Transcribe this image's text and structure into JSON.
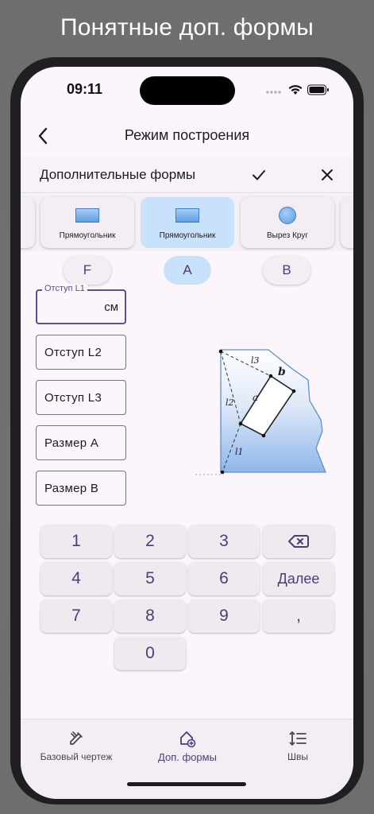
{
  "promo_title": "Понятные доп. формы",
  "status": {
    "time": "09:11"
  },
  "nav": {
    "title": "Режим построения",
    "back_icon": "chevron-left-icon"
  },
  "sheet": {
    "title": "Дополнительные формы",
    "confirm_icon": "check-icon",
    "close_icon": "close-icon"
  },
  "shapes": [
    {
      "label": "Прямоугольник",
      "icon": "rectangle-icon",
      "selected": false
    },
    {
      "label": "Прямоугольник",
      "icon": "rectangle-icon",
      "selected": true
    },
    {
      "label": "Вырез Круг",
      "icon": "circle-icon",
      "selected": false
    }
  ],
  "tabs": [
    {
      "label": "F",
      "selected": false
    },
    {
      "label": "A",
      "selected": true
    },
    {
      "label": "B",
      "selected": false
    }
  ],
  "fields": [
    {
      "label": "Отступ L1",
      "value": "",
      "unit": "см",
      "active": true
    },
    {
      "placeholder": "Отступ L2"
    },
    {
      "placeholder": "Отступ L3"
    },
    {
      "placeholder": "Размер A"
    },
    {
      "placeholder": "Размер B"
    }
  ],
  "diagram": {
    "labels": {
      "l1": "l1",
      "l2": "l2",
      "l3": "l3",
      "a": "a",
      "b": "b"
    }
  },
  "keypad": {
    "keys": [
      "1",
      "2",
      "3",
      "4",
      "5",
      "6",
      "7",
      "8",
      "9",
      ",",
      "0"
    ],
    "next_label": "Далее",
    "backspace_icon": "backspace-icon"
  },
  "bottom_nav": [
    {
      "label": "Базовый чертеж",
      "icon": "pencil-ruler-icon",
      "active": false
    },
    {
      "label": "Доп. формы",
      "icon": "add-shape-icon",
      "active": true
    },
    {
      "label": "Швы",
      "icon": "seams-icon",
      "active": false
    }
  ],
  "colors": {
    "accent": "#4a3d7a",
    "selected": "#c8e2fb",
    "background": "#fcf5fc",
    "shape_fill": "#5f9ee6"
  }
}
